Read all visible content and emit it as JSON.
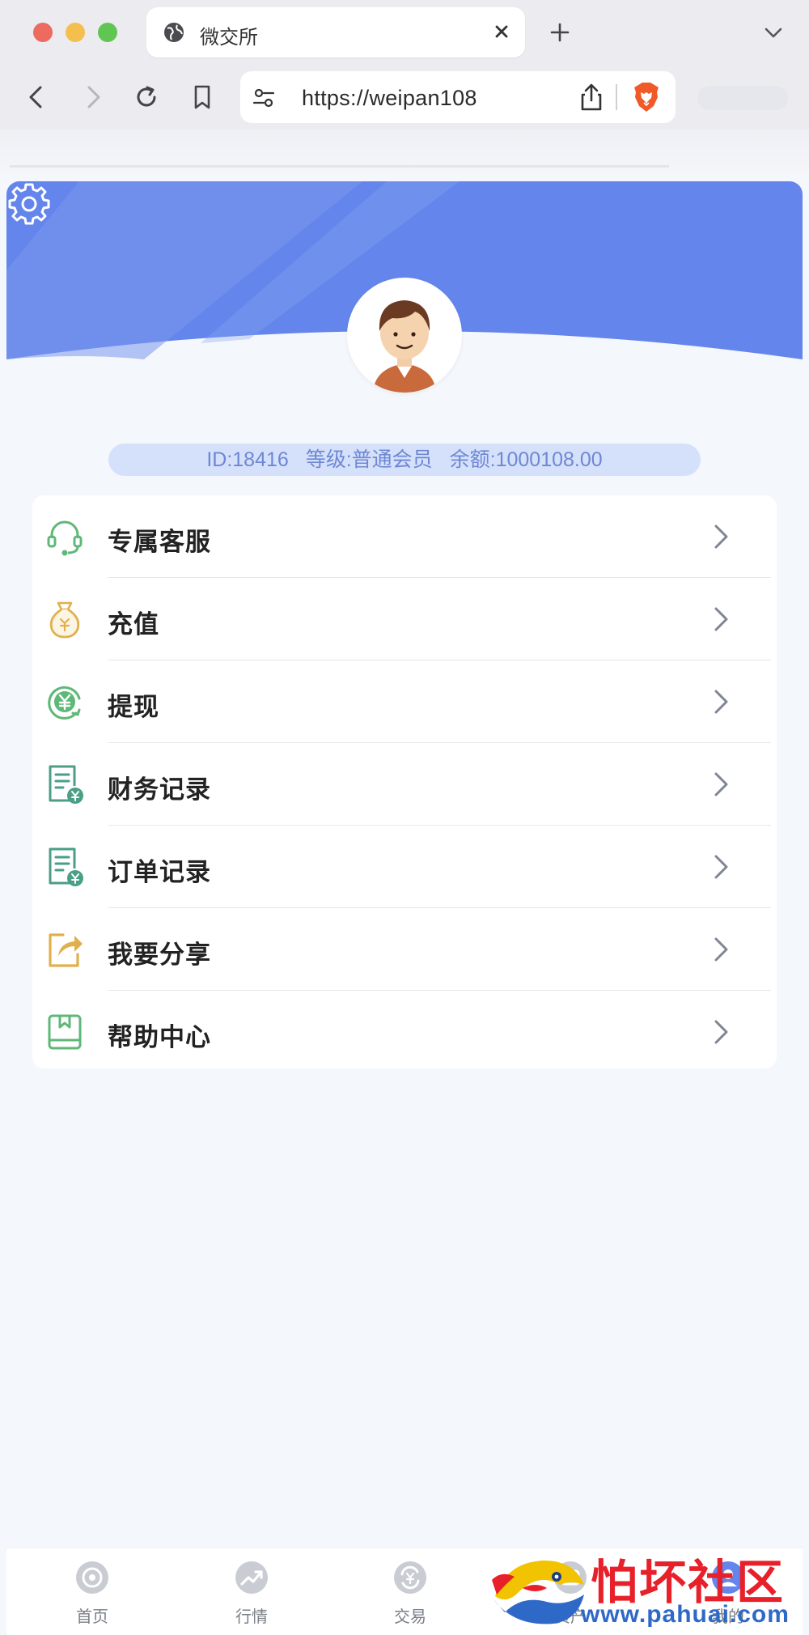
{
  "browser": {
    "tab_title": "微交所",
    "url": "https://weipan108"
  },
  "profile": {
    "id_text": "ID:18416",
    "level_text": "等级:普通会员",
    "balance_text": "余额:1000108.00"
  },
  "menu": {
    "items": [
      {
        "label": "专属客服",
        "icon": "headset-icon",
        "color": "#5fb878"
      },
      {
        "label": "充值",
        "icon": "money-bag-icon",
        "color": "#e0b04c"
      },
      {
        "label": "提现",
        "icon": "yuan-cycle-icon",
        "color": "#5fb878"
      },
      {
        "label": "财务记录",
        "icon": "finance-record-icon",
        "color": "#4a9f86"
      },
      {
        "label": "订单记录",
        "icon": "order-record-icon",
        "color": "#4a9f86"
      },
      {
        "label": "我要分享",
        "icon": "share-icon",
        "color": "#e0b04c"
      },
      {
        "label": "帮助中心",
        "icon": "help-book-icon",
        "color": "#5fb878"
      }
    ]
  },
  "tabbar": {
    "items": [
      {
        "label": "首页",
        "icon": "home-icon"
      },
      {
        "label": "行情",
        "icon": "trend-icon"
      },
      {
        "label": "交易",
        "icon": "exchange-icon"
      },
      {
        "label": "资产",
        "icon": "asset-icon"
      },
      {
        "label": "我的",
        "icon": "profile-icon"
      }
    ]
  },
  "watermark": {
    "title": "怕坏社区",
    "url": "www.pahuai.com"
  },
  "colors": {
    "banner": "#6486ec",
    "page_bg": "#f4f7fb",
    "accent_text": "#6f87d4"
  }
}
